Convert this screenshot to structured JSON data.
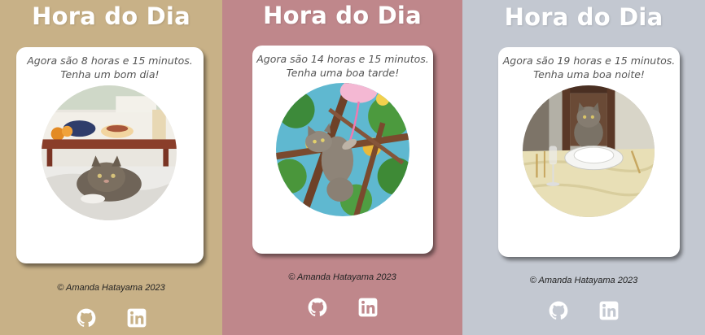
{
  "panels": [
    {
      "id": "morning",
      "title": "Hora do Dia",
      "greeting_line1": "Agora são 8 horas e 15 minutos.",
      "greeting_line2": "Tenha um bom dia!",
      "photo_icon": "cat-under-breakfast-tray-photo",
      "footer": "© Amanda Hatayama 2023",
      "background": "#c8b187"
    },
    {
      "id": "afternoon",
      "title": "Hora do Dia",
      "greeting_line1": "Agora são 14 horas e 15 minutos.",
      "greeting_line2": "Tenha uma boa tarde!",
      "photo_icon": "cat-in-tree-photo",
      "footer": "© Amanda Hatayama 2023",
      "background": "#bf878b"
    },
    {
      "id": "night",
      "title": "Hora do Dia",
      "greeting_line1": "Agora são 19 horas e 15 minutos.",
      "greeting_line2": "Tenha uma boa noite!",
      "photo_icon": "cat-at-dinner-table-photo",
      "footer": "© Amanda Hatayama 2023",
      "background": "#c3c8d1"
    }
  ],
  "social_icons": [
    "github-icon",
    "linkedin-icon"
  ]
}
